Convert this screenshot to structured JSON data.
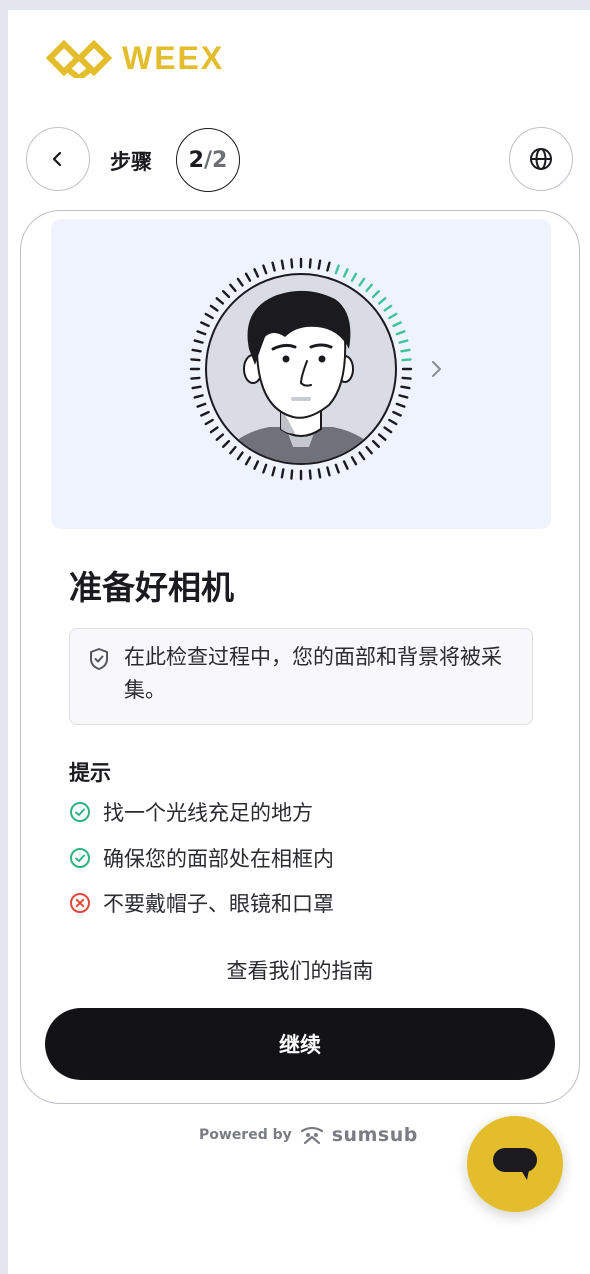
{
  "brand": {
    "name": "WEEX",
    "color": "#e3bd2b"
  },
  "nav": {
    "back_icon": "chevron-left-icon",
    "step_label": "步骤",
    "step_current": "2",
    "step_total": "/2",
    "language_icon": "globe-icon"
  },
  "card": {
    "title": "准备好相机",
    "notice_icon": "shield-icon",
    "notice_text": "在此检查过程中，您的面部和背景将被采集。",
    "tips_heading": "提示",
    "tips": [
      {
        "text": "找一个光线充足的地方",
        "status": "ok",
        "icon": "check-circle-icon",
        "color": "#2fb37f"
      },
      {
        "text": "确保您的面部处在相框内",
        "status": "ok",
        "icon": "check-circle-icon",
        "color": "#2fb37f"
      },
      {
        "text": "不要戴帽子、眼镜和口罩",
        "status": "bad",
        "icon": "x-circle-icon",
        "color": "#e5473d"
      }
    ],
    "guide_link": "查看我们的指南",
    "continue_label": "继续"
  },
  "footer": {
    "powered_by": "Powered by",
    "provider": "sumsub"
  },
  "chat": {
    "icon": "chat-bubble-icon"
  }
}
